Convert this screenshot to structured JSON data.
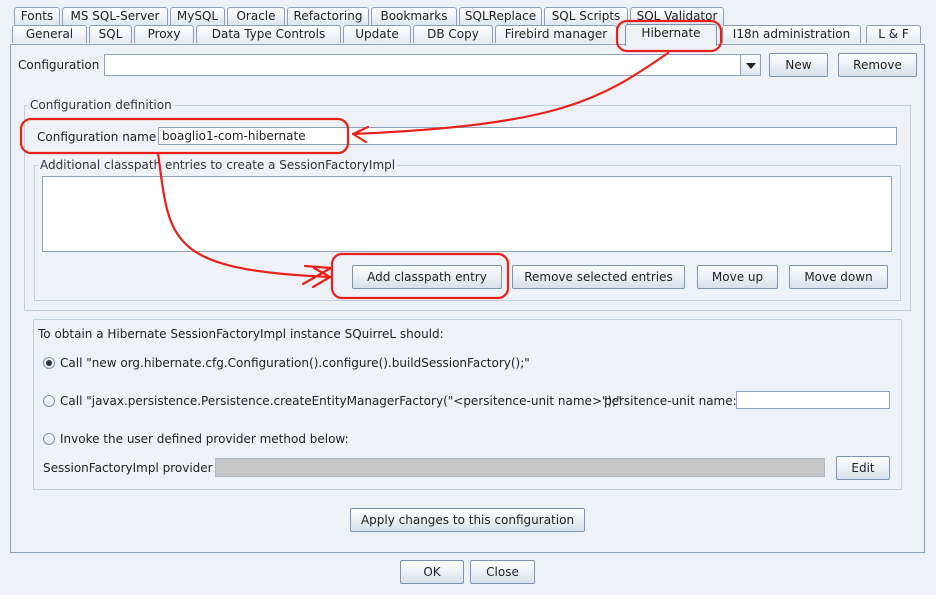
{
  "tabs_row1": [
    "Fonts",
    "MS SQL-Server",
    "MySQL",
    "Oracle",
    "Refactoring",
    "Bookmarks",
    "SQLReplace",
    "SQL Scripts",
    "SQL Validator"
  ],
  "tabs_row2": [
    "General",
    "SQL",
    "Proxy",
    "Data Type Controls",
    "Update",
    "DB Copy",
    "Firebird manager",
    "Hibernate",
    "I18n administration",
    "L & F"
  ],
  "selected_tab": "Hibernate",
  "configuration": {
    "label": "Configuration",
    "value": "",
    "new_label": "New",
    "remove_label": "Remove"
  },
  "definition": {
    "title": "Configuration definition",
    "name_label": "Configuration name",
    "name_value": "boaglio1-com-hibernate",
    "classpath_title": "Additional classpath entries to create a SessionFactoryImpl",
    "add_label": "Add classpath entry",
    "remove_selected_label": "Remove selected entries",
    "move_up_label": "Move up",
    "move_down_label": "Move down"
  },
  "obtain": {
    "title": "To obtain a Hibernate SessionFactoryImpl instance SQuirreL should:",
    "option1": "Call \"new org.hibernate.cfg.Configuration().configure().buildSessionFactory();\"",
    "option2": "Call \"javax.persistence.Persistence.createEntityManagerFactory(\"<persitence-unit name>\");\"",
    "persistence_unit_label": "persitence-unit name:",
    "persistence_unit_value": "",
    "option3": "Invoke the user defined provider method below:",
    "provider_label": "SessionFactoryImpl provider",
    "edit_label": "Edit",
    "selected_option": 1
  },
  "apply_label": "Apply changes to this configuration",
  "ok_label": "OK",
  "close_label": "Close",
  "annotation_color": "#e8201a"
}
